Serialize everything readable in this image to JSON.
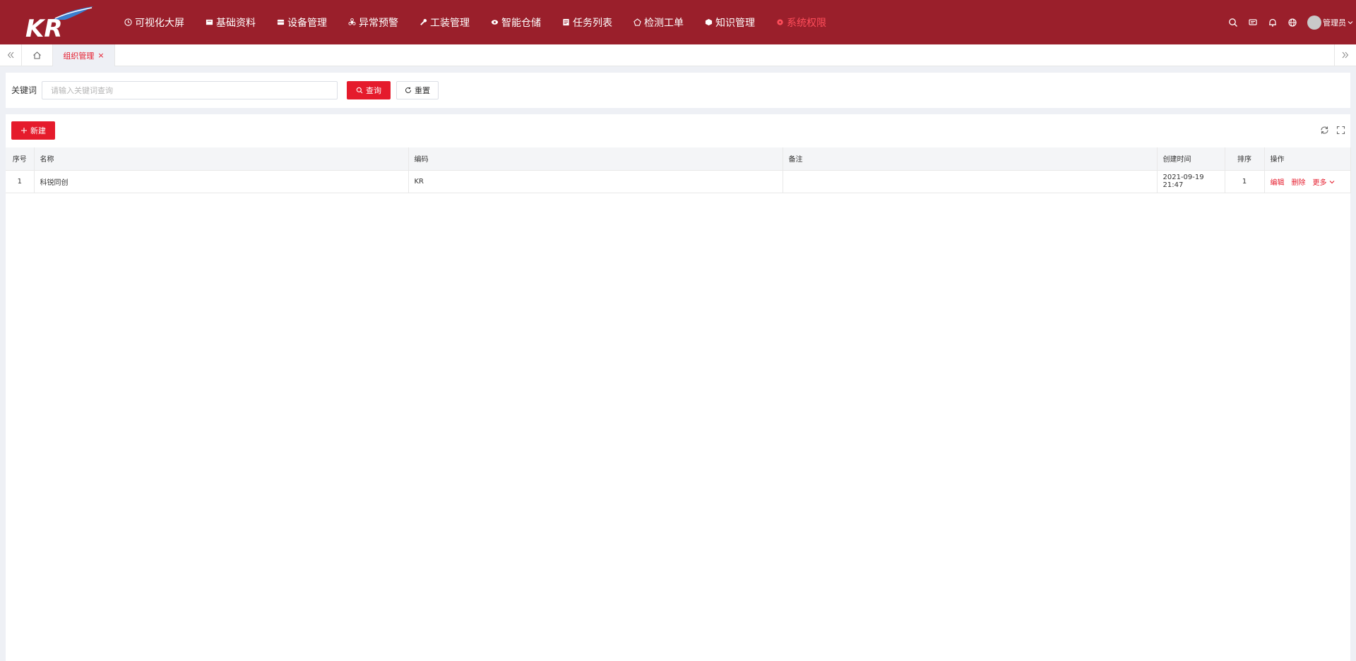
{
  "header": {
    "logo_text": "KR",
    "nav": [
      {
        "label": "可视化大屏",
        "icon": "clock-icon"
      },
      {
        "label": "基础资料",
        "icon": "folder-icon"
      },
      {
        "label": "设备管理",
        "icon": "device-icon"
      },
      {
        "label": "异常预警",
        "icon": "alert-icon"
      },
      {
        "label": "工装管理",
        "icon": "wrench-icon"
      },
      {
        "label": "智能仓储",
        "icon": "eye-icon"
      },
      {
        "label": "任务列表",
        "icon": "list-icon"
      },
      {
        "label": "检测工单",
        "icon": "inspect-icon"
      },
      {
        "label": "知识管理",
        "icon": "book-icon"
      },
      {
        "label": "系统权限",
        "icon": "settings-icon",
        "active": true
      }
    ],
    "user_name": "管理员",
    "colors": {
      "header_bg": "#9a1f2b",
      "active_nav": "#ff4d5a"
    }
  },
  "tabs": {
    "active_tab": "组织管理",
    "close_glyph": "×"
  },
  "search": {
    "label": "关键词",
    "placeholder": "请输入关键词查询",
    "value": "",
    "query_label": "查询",
    "reset_label": "重置"
  },
  "toolbar": {
    "new_label": "新建"
  },
  "table": {
    "columns": [
      "序号",
      "名称",
      "编码",
      "备注",
      "创建时间",
      "排序",
      "操作"
    ],
    "rows": [
      {
        "index": "1",
        "name": "科锐同创",
        "code": "KR",
        "remark": "",
        "created": "2021-09-19 21:47",
        "sort": "1",
        "actions": {
          "edit": "编辑",
          "delete": "删除",
          "more": "更多"
        }
      }
    ]
  },
  "accent_color": "#e51b2c"
}
